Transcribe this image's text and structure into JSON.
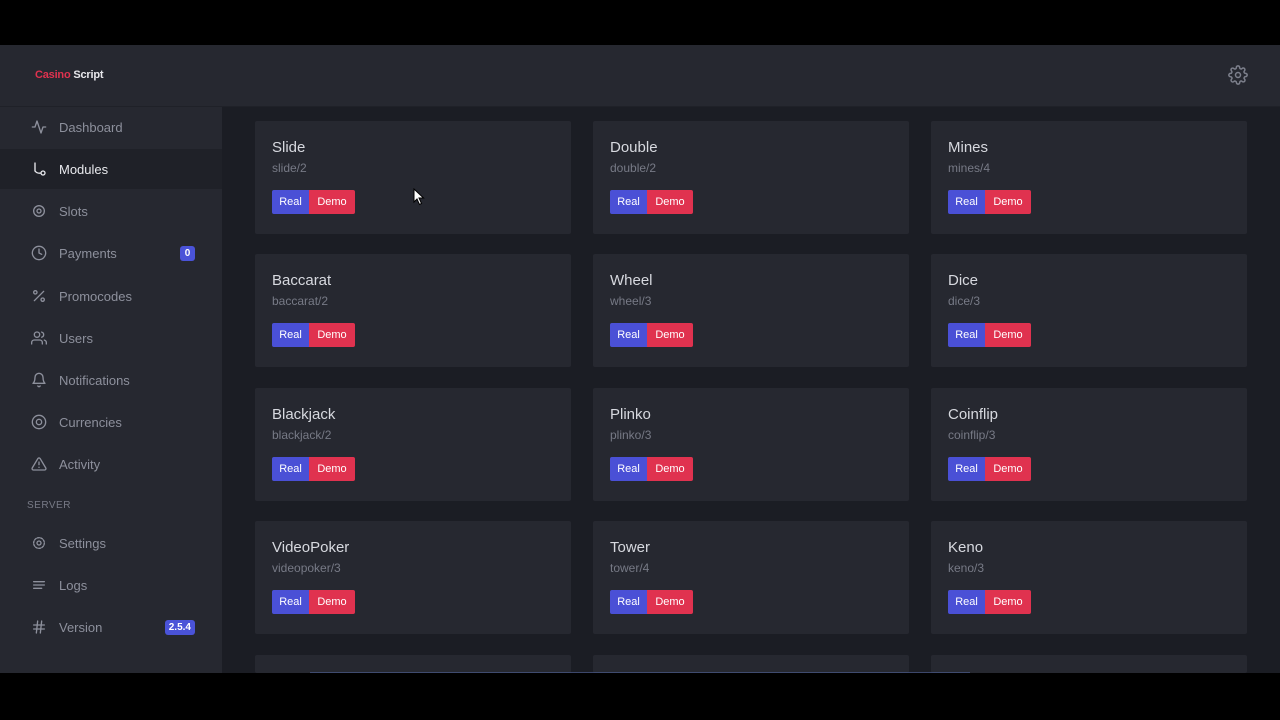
{
  "app": {
    "logo_part1": "Casino",
    "logo_part2": "Script"
  },
  "sidebar": {
    "items": [
      {
        "label": "Dashboard",
        "icon": "activity-icon"
      },
      {
        "label": "Modules",
        "icon": "git-branch-icon",
        "active": true
      },
      {
        "label": "Slots",
        "icon": "cpu-icon"
      },
      {
        "label": "Payments",
        "icon": "clock-icon",
        "badge": "0"
      },
      {
        "label": "Promocodes",
        "icon": "percent-icon"
      },
      {
        "label": "Users",
        "icon": "users-icon"
      },
      {
        "label": "Notifications",
        "icon": "bell-icon"
      },
      {
        "label": "Currencies",
        "icon": "target-icon"
      },
      {
        "label": "Activity",
        "icon": "alert-triangle-icon"
      }
    ],
    "section_server": "SERVER",
    "server_items": [
      {
        "label": "Settings",
        "icon": "gear-icon"
      },
      {
        "label": "Logs",
        "icon": "align-icon"
      },
      {
        "label": "Version",
        "icon": "hash-icon",
        "badge": "2.5.4"
      }
    ]
  },
  "modules": [
    {
      "name": "Slide",
      "path": "slide/2"
    },
    {
      "name": "Double",
      "path": "double/2"
    },
    {
      "name": "Mines",
      "path": "mines/4"
    },
    {
      "name": "Baccarat",
      "path": "baccarat/2"
    },
    {
      "name": "Wheel",
      "path": "wheel/3"
    },
    {
      "name": "Dice",
      "path": "dice/3"
    },
    {
      "name": "Blackjack",
      "path": "blackjack/2"
    },
    {
      "name": "Plinko",
      "path": "plinko/3"
    },
    {
      "name": "Coinflip",
      "path": "coinflip/3"
    },
    {
      "name": "VideoPoker",
      "path": "videopoker/3"
    },
    {
      "name": "Tower",
      "path": "tower/4"
    },
    {
      "name": "Keno",
      "path": "keno/3"
    }
  ],
  "buttons": {
    "real": "Real",
    "demo": "Demo"
  },
  "colors": {
    "accent_blue": "#4a50d6",
    "accent_red": "#e0324f",
    "panel": "#262830",
    "background": "#1b1d24"
  }
}
